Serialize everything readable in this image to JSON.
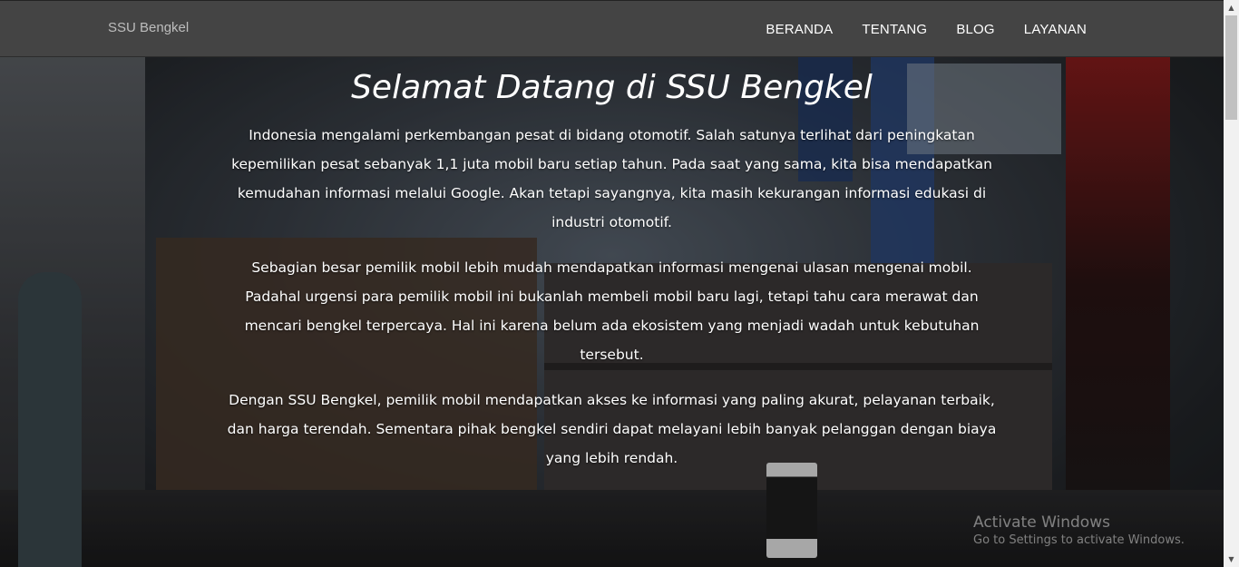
{
  "navbar": {
    "brand": "SSU Bengkel",
    "items": [
      {
        "label": "BERANDA"
      },
      {
        "label": "TENTANG"
      },
      {
        "label": "BLOG"
      },
      {
        "label": "LAYANAN"
      }
    ]
  },
  "hero": {
    "title": "Selamat Datang di SSU Bengkel",
    "paragraphs": [
      "Indonesia mengalami perkembangan pesat di bidang otomotif. Salah satunya terlihat dari peningkatan kepemilikan pesat sebanyak 1,1 juta mobil baru setiap tahun. Pada saat yang sama, kita bisa mendapatkan kemudahan informasi melalui Google. Akan tetapi sayangnya, kita masih kekurangan informasi edukasi di industri otomotif.",
      "Sebagian besar pemilik mobil lebih mudah mendapatkan informasi mengenai ulasan mengenai mobil. Padahal urgensi para pemilik mobil ini bukanlah membeli mobil baru lagi, tetapi tahu cara merawat dan mencari bengkel terpercaya. Hal ini karena belum ada ekosistem yang menjadi wadah untuk kebutuhan tersebut.",
      "Dengan SSU Bengkel, pemilik mobil mendapatkan akses ke informasi yang paling akurat, pelayanan terbaik, dan harga terendah. Sementara pihak bengkel sendiri dapat melayani lebih banyak pelanggan dengan biaya yang lebih rendah."
    ]
  },
  "watermark": {
    "title": "Activate Windows",
    "subtitle": "Go to Settings to activate Windows."
  },
  "colors": {
    "navbar_bg": "#444444",
    "nav_text": "#ffffff",
    "brand_text": "#bdbdbd"
  }
}
